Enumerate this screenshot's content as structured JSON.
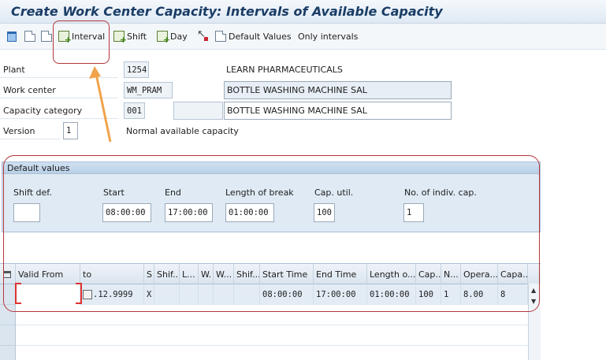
{
  "window": {
    "title": "Create Work Center Capacity: Intervals of Available Capacity"
  },
  "toolbar": {
    "items": [
      {
        "icon": "trash-icon",
        "label": ""
      },
      {
        "icon": "document-icon",
        "label": ""
      },
      {
        "icon": "copy-icon",
        "label": ""
      },
      {
        "icon": "interval-icon",
        "label": "Interval"
      },
      {
        "icon": "shift-icon",
        "label": "Shift"
      },
      {
        "icon": "day-icon",
        "label": "Day"
      },
      {
        "icon": "cursor-icon",
        "label": ""
      },
      {
        "icon": "page-icon",
        "label": "Default Values"
      },
      {
        "icon": "",
        "label": "Only intervals"
      }
    ]
  },
  "header": {
    "plant": {
      "label": "Plant",
      "value": "1254",
      "description": "LEARN PHARMACEUTICALS"
    },
    "work_center": {
      "label": "Work center",
      "value": "WM_PRAM",
      "description": "BOTTLE WASHING MACHINE SAL"
    },
    "capacity_category": {
      "label": "Capacity category",
      "value": "001",
      "extra": "",
      "description": "BOTTLE WASHING MACHINE SAL"
    },
    "version": {
      "label": "Version",
      "value": "1",
      "description": "Normal available capacity"
    }
  },
  "default_values": {
    "title": "Default values",
    "shift_def": {
      "label": "Shift def.",
      "value": ""
    },
    "start": {
      "label": "Start",
      "value": "08:00:00"
    },
    "end": {
      "label": "End",
      "value": "17:00:00"
    },
    "length_of_break": {
      "label": "Length of break",
      "value": "01:00:00"
    },
    "cap_util": {
      "label": "Cap. util.",
      "value": "100"
    },
    "no_indiv_cap": {
      "label": "No. of indiv. cap.",
      "value": "1"
    }
  },
  "table": {
    "columns": [
      "Valid From",
      "to",
      "S",
      "Shif...",
      "L...",
      "W.",
      "W...",
      "Shif...",
      "Start Time",
      "End Time",
      "Length o...",
      "Cap...",
      "N...",
      "Opera...",
      "Capa..."
    ],
    "rows": [
      [
        "",
        ".12.9999",
        "X",
        "",
        "",
        "",
        "",
        "",
        "08:00:00",
        "17:00:00",
        "01:00:00",
        "100",
        "1",
        "8.00",
        "8"
      ]
    ]
  },
  "colors": {
    "title": "#1a3d66",
    "annotation": "#b5373c",
    "arrow": "#f0a34a",
    "group_bg": "#dfeaf4"
  }
}
